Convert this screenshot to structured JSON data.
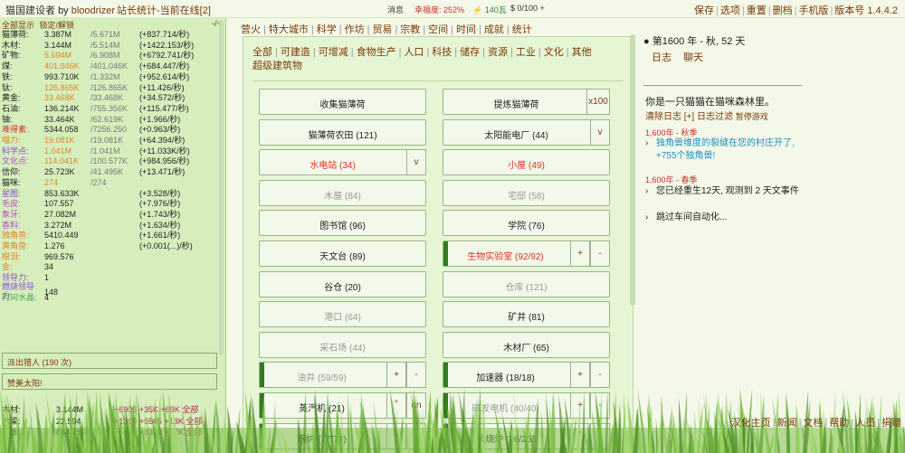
{
  "header": {
    "title": "猫国建设者",
    "by": "by",
    "author": "bloodrizer",
    "stats_link": "站长统计-当前在线[2]",
    "messages": "消息",
    "happiness": "幸福度: 252%",
    "energy": "⚡ 140瓦",
    "money": "$ 0/100 +",
    "menu": [
      "保存",
      "选项",
      "重置",
      "删档",
      "手机版",
      "版本号 1.4.4.2"
    ]
  },
  "left": {
    "show_all": "全部显示",
    "lock_unlock": "锁定/解锁",
    "switch": "-/+",
    "resources": [
      {
        "name": "猫薄荷:",
        "value": "3.387M",
        "max": "/5.671M",
        "rate": "(+837.714/秒)",
        "color": "#222"
      },
      {
        "name": "木材:",
        "value": "3.144M",
        "max": "/5.514M",
        "rate": "(+1422.153/秒)",
        "color": "#222"
      },
      {
        "name": "矿物:",
        "value": "5.694M",
        "max": "/6.908M",
        "rate": "(+6792.741/秒)",
        "color": "#e0872a"
      },
      {
        "name": "煤:",
        "value": "401.046K",
        "max": "/401.046K",
        "rate": "(+684.447/秒)",
        "color": "#e0872a"
      },
      {
        "name": "铁:",
        "value": "993.710K",
        "max": "/1.332M",
        "rate": "(+952.614/秒)",
        "color": "#222"
      },
      {
        "name": "钛:",
        "value": "126.865K",
        "max": "/126.865K",
        "rate": "(+11.426/秒)",
        "color": "#e0872a"
      },
      {
        "name": "黄金:",
        "value": "33.468K",
        "max": "/33.468K",
        "rate": "(+34.572/秒)",
        "color": "#e0872a"
      },
      {
        "name": "石油:",
        "value": "136.214K",
        "max": "/755.356K",
        "rate": "(+115.477/秒)",
        "color": "#222"
      },
      {
        "name": "铀:",
        "value": "33.464K",
        "max": "/62.619K",
        "rate": "(+1.966/秒)",
        "color": "#222"
      },
      {
        "name": "难得素:",
        "value": "5344.058",
        "max": "/7256.250",
        "rate": "(+0.963/秒)",
        "color": "#222"
      },
      {
        "name": "喵力:",
        "value": "19.081K",
        "max": "/19.081K",
        "rate": "(+64.394/秒)",
        "color": "#e0872a"
      },
      {
        "name": "科学点:",
        "value": "1.041M",
        "max": "/1.041M",
        "rate": "(+11.033K/秒)",
        "color": "#e0872a"
      },
      {
        "name": "文化点:",
        "value": "114.041K",
        "max": "/100.577K",
        "rate": "(+984.956/秒)",
        "color": "#e0872a"
      },
      {
        "name": "信仰:",
        "value": "25.723K",
        "max": "/41.495K",
        "rate": "(+13.471/秒)",
        "color": "#222"
      },
      {
        "name": "猫咪:",
        "value": "274",
        "max": "/274",
        "rate": "",
        "color": "#e0872a"
      },
      {
        "name": "星图:",
        "value": "853.633K",
        "max": "",
        "rate": "(+3.528/秒)",
        "color": "#222"
      },
      {
        "name": "毛皮:",
        "value": "107.557",
        "max": "",
        "rate": "(+7.976/秒)",
        "color": "#222"
      },
      {
        "name": "象牙:",
        "value": "27.082M",
        "max": "",
        "rate": "(+1.743/秒)",
        "color": "#222"
      },
      {
        "name": "香料:",
        "value": "3.272M",
        "max": "",
        "rate": "(+1.634/秒)",
        "color": "#222"
      },
      {
        "name": "独角兽:",
        "value": "5410.449",
        "max": "",
        "rate": "(+1.661/秒)",
        "color": "#222"
      },
      {
        "name": "黄角兽:",
        "value": "1.276",
        "max": "",
        "rate": "(+0.001(...)/秒)",
        "color": "#222"
      },
      {
        "name": "眼泪:",
        "value": "969.576",
        "max": "",
        "rate": "",
        "color": "#222"
      },
      {
        "name": "金:",
        "value": "34",
        "max": "",
        "rate": "",
        "color": "#222"
      },
      {
        "name": "领导力:",
        "value": "1",
        "max": "",
        "rate": "",
        "color": "#222"
      },
      {
        "name": "燃烧领导力:",
        "value": "148",
        "max": "",
        "rate": "",
        "color": "#222"
      },
      {
        "name": "时间水晶:",
        "value": "4",
        "max": "",
        "rate": "",
        "color": "#222"
      }
    ],
    "name_colors": [
      "#222",
      "#222",
      "#222",
      "#222",
      "#222",
      "#222",
      "#222",
      "#222",
      "#222",
      "#c33",
      "#e0872a",
      "#8a4bd0",
      "#b54bd0",
      "#222",
      "#222",
      "#8a4bd0",
      "#b54bd0",
      "#b54bd0",
      "#b54bd0",
      "#e0872a",
      "#e0872a",
      "#e0872a",
      "#e0872a",
      "#8a4bd0",
      "#8a4bd0",
      "#4aa85a"
    ],
    "hunt": "派出猎人 (190 次)",
    "praise": "赞美太阳!",
    "bottom": [
      {
        "name": "木材:",
        "value": "3.144M",
        "actions": "+6905 +35K +69K 全部"
      },
      {
        "name": "木梁:",
        "value": "22.594",
        "actions": "+1309 +6565 +13K 全部"
      },
      {
        "name": "石板:",
        "value": "884.959K",
        "actions": "+1660 +8312 +17K 全部"
      }
    ]
  },
  "tabs": [
    "营火",
    "特大城市",
    "科学",
    "作坊",
    "贸易",
    "宗教",
    "空间",
    "时间",
    "成就",
    "统计"
  ],
  "filters": [
    "全部",
    "可建造",
    "可增减",
    "食物生产",
    "人口",
    "科技",
    "储存",
    "资源",
    "工业",
    "文化",
    "其他",
    "超级建筑物"
  ],
  "buildings": [
    {
      "label": "收集猫薄荷",
      "style": ""
    },
    {
      "label": "提炼猫薄荷",
      "style": "",
      "side": "x100"
    },
    {
      "label": "猫薄荷农田 (121)",
      "style": ""
    },
    {
      "label": "太阳能电厂 (44)",
      "style": "",
      "side": "v"
    },
    {
      "label": "水电站 (34)",
      "style": "red",
      "side": "v"
    },
    {
      "label": "小屋 (49)",
      "style": "red"
    },
    {
      "label": "木屋 (84)",
      "style": "dis"
    },
    {
      "label": "宅邸 (58)",
      "style": "dis"
    },
    {
      "label": "图书馆 (96)",
      "style": ""
    },
    {
      "label": "学院 (76)",
      "style": ""
    },
    {
      "label": "天文台 (89)",
      "style": ""
    },
    {
      "label": "生物实验室 (92/92)",
      "style": "red",
      "bar": true,
      "plus": "+",
      "minus": "-"
    },
    {
      "label": "谷仓 (20)",
      "style": ""
    },
    {
      "label": "仓库 (121)",
      "style": "dis"
    },
    {
      "label": "港口 (64)",
      "style": "dis"
    },
    {
      "label": "矿井 (81)",
      "style": ""
    },
    {
      "label": "采石场 (44)",
      "style": "dis"
    },
    {
      "label": "木材厂 (65)",
      "style": ""
    },
    {
      "label": "油井 (59/59)",
      "style": "dis",
      "bar": true,
      "plus": "+",
      "minus": "-"
    },
    {
      "label": "加速器 (18/18)",
      "style": "",
      "bar": true,
      "plus": "+",
      "minus": "-"
    },
    {
      "label": "蒸汽机 (21)",
      "style": "",
      "bar": true,
      "plus": "˚",
      "minus": "on"
    },
    {
      "label": "磁发电机 (40/40)",
      "style": "dis",
      "bar": true,
      "plus": "+",
      "minus": "-"
    },
    {
      "label": "熔炉 (77/77)",
      "style": "",
      "bar": true,
      "plus": "+",
      "minus": "-"
    },
    {
      "label": "锻烧炉 (26/26)",
      "style": "",
      "bar": true,
      "plus": "˚",
      "minus": "-"
    }
  ],
  "right": {
    "date": "第1600 年 - 秋, 52 天",
    "links": [
      "日志",
      "聊天"
    ],
    "story": "你是一只猫猫在猫咪森林里。",
    "log_controls": "清除日志 [+] 日志过滤",
    "pause": "暂停游戏",
    "season1": "1,600年 - 秋季",
    "log1": [
      "独角兽维度的裂缝在您的村庄开了,",
      "+755个独角兽!"
    ],
    "season2": "1,600年 - 春季",
    "log2": [
      "您已经重生12天, 观测到 2 天文事件",
      "跳过车间自动化..."
    ]
  },
  "footer": [
    "汉化主页",
    "新闻",
    "文档",
    "帮助",
    "人员",
    "捐赠"
  ]
}
